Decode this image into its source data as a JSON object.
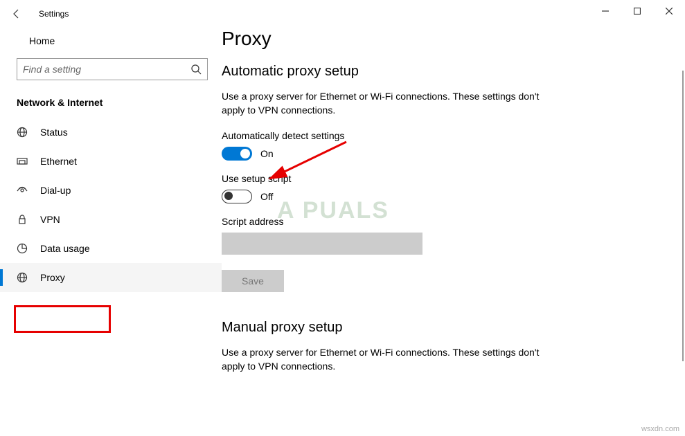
{
  "window": {
    "title": "Settings"
  },
  "sidebar": {
    "home_label": "Home",
    "search_placeholder": "Find a setting",
    "category": "Network & Internet",
    "items": [
      {
        "label": "Status"
      },
      {
        "label": "Ethernet"
      },
      {
        "label": "Dial-up"
      },
      {
        "label": "VPN"
      },
      {
        "label": "Data usage"
      },
      {
        "label": "Proxy"
      }
    ]
  },
  "main": {
    "page_title": "Proxy",
    "section_auto_title": "Automatic proxy setup",
    "auto_desc": "Use a proxy server for Ethernet or Wi-Fi connections. These settings don't apply to VPN connections.",
    "auto_detect_label": "Automatically detect settings",
    "auto_detect_state": "On",
    "setup_script_label": "Use setup script",
    "setup_script_state": "Off",
    "script_addr_label": "Script address",
    "script_addr_value": "",
    "save_label": "Save",
    "section_manual_title": "Manual proxy setup",
    "manual_desc": "Use a proxy server for Ethernet or Wi-Fi connections. These settings don't apply to VPN connections."
  },
  "watermark": "A  PUALS",
  "footer_brand": "wsxdn.com"
}
